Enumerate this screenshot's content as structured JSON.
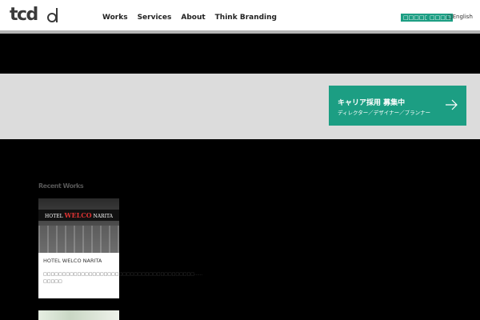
{
  "header": {
    "logo_text": "tcd",
    "logo_mark": "d",
    "nav": [
      "Works",
      "Services",
      "About",
      "Think Branding"
    ],
    "btn_contact": "□□□□□□",
    "btn_access": "□□□□",
    "lang_label": "□English"
  },
  "banner": {
    "career_title": "キャリア採用 募集中",
    "career_sub": "ディレクター／デザイナー／プランナー",
    "arrow_icon": "arrow-right-icon"
  },
  "works": {
    "section_title": "Recent Works",
    "cards": [
      {
        "sign_prefix": "HOTEL",
        "sign_brand": "WELCO",
        "sign_suffix": "NARITA",
        "title": "HOTEL WELCO NARITA",
        "desc": "□□□□□□□□□□□□□□□□□□□□□□□□□□□□□□□□□□□□□□□□……□□□□□"
      }
    ]
  },
  "colors": {
    "accent": "#1c9e83",
    "banner_bg": "#dcdcdc",
    "page_bg": "#000000"
  }
}
